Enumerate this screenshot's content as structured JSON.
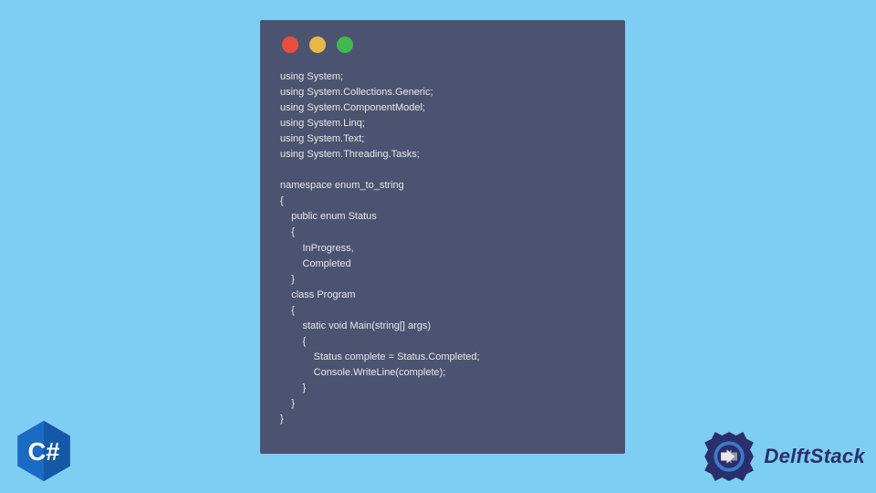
{
  "code": {
    "lines": [
      "using System;",
      "using System.Collections.Generic;",
      "using System.ComponentModel;",
      "using System.Linq;",
      "using System.Text;",
      "using System.Threading.Tasks;",
      "",
      "namespace enum_to_string",
      "{",
      "    public enum Status",
      "    {",
      "        InProgress,",
      "        Completed",
      "    }",
      "    class Program",
      "    {",
      "        static void Main(string[] args)",
      "        {",
      "            Status complete = Status.Completed;",
      "            Console.WriteLine(complete);",
      "        }",
      "    }",
      "}"
    ]
  },
  "badges": {
    "csharp_label": "C#",
    "delftstack_label": "DelftStack"
  },
  "colors": {
    "background": "#7ecdf2",
    "window": "#4c5370",
    "csharp_badge": "#1a6bc4",
    "delft_primary": "#2a2f6b",
    "delft_accent": "#3a7bc8"
  }
}
